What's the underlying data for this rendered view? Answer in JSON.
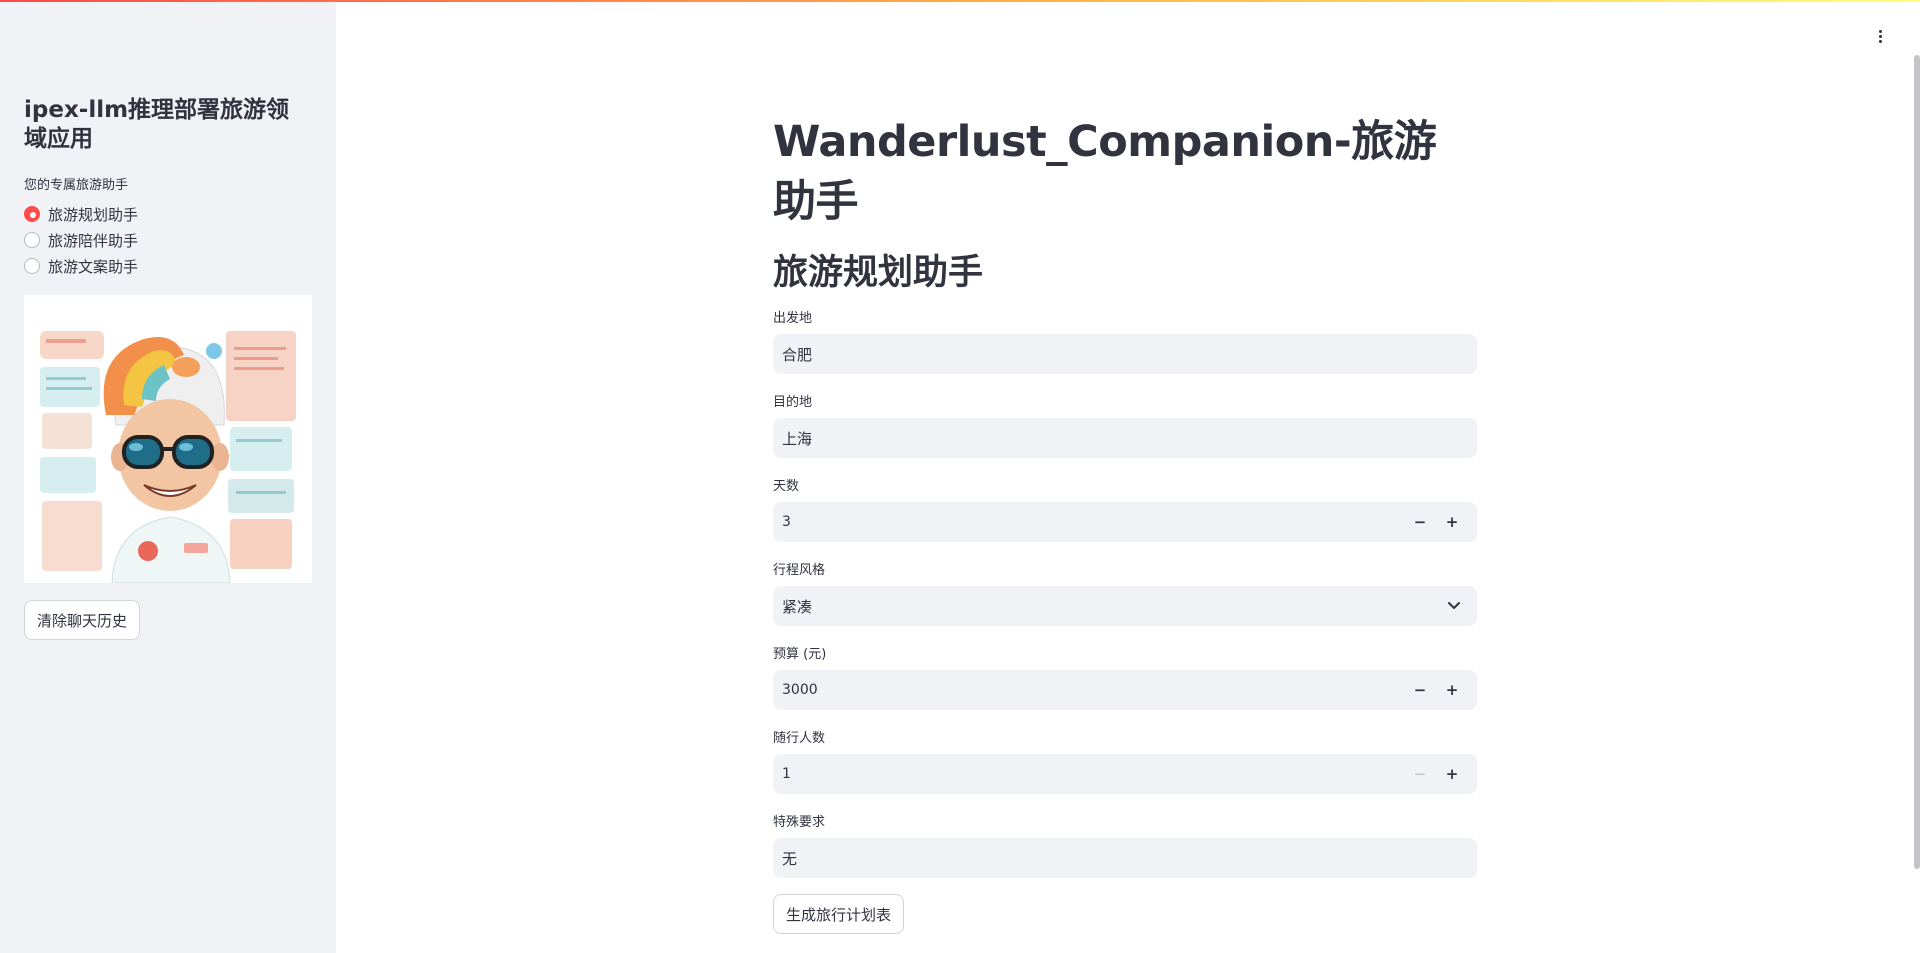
{
  "sidebar": {
    "title": "ipex-llm推理部署旅游领域应用",
    "radio_caption": "您的专属旅游助手",
    "options": [
      {
        "label": "旅游规划助手",
        "selected": true
      },
      {
        "label": "旅游陪伴助手",
        "selected": false
      },
      {
        "label": "旅游文案助手",
        "selected": false
      }
    ],
    "image_description": "cartoon-traveler-avatar",
    "clear_button": "清除聊天历史"
  },
  "main": {
    "title": "Wanderlust_Companion-旅游助手",
    "subtitle": "旅游规划助手",
    "fields": {
      "departure": {
        "label": "出发地",
        "value": "合肥"
      },
      "destination": {
        "label": "目的地",
        "value": "上海"
      },
      "days": {
        "label": "天数",
        "value": "3"
      },
      "style": {
        "label": "行程风格",
        "value": "紧凑"
      },
      "budget": {
        "label": "预算 (元)",
        "value": "3000"
      },
      "people": {
        "label": "随行人数",
        "value": "1"
      },
      "special": {
        "label": "特殊要求",
        "value": "无"
      }
    },
    "submit_button": "生成旅行计划表"
  },
  "colors": {
    "accent": "#ff4b4b",
    "sidebar_bg": "#f0f2f6",
    "input_bg": "#f0f2f6",
    "text": "#31333f"
  },
  "icons": {
    "minus": "−",
    "plus": "+"
  }
}
